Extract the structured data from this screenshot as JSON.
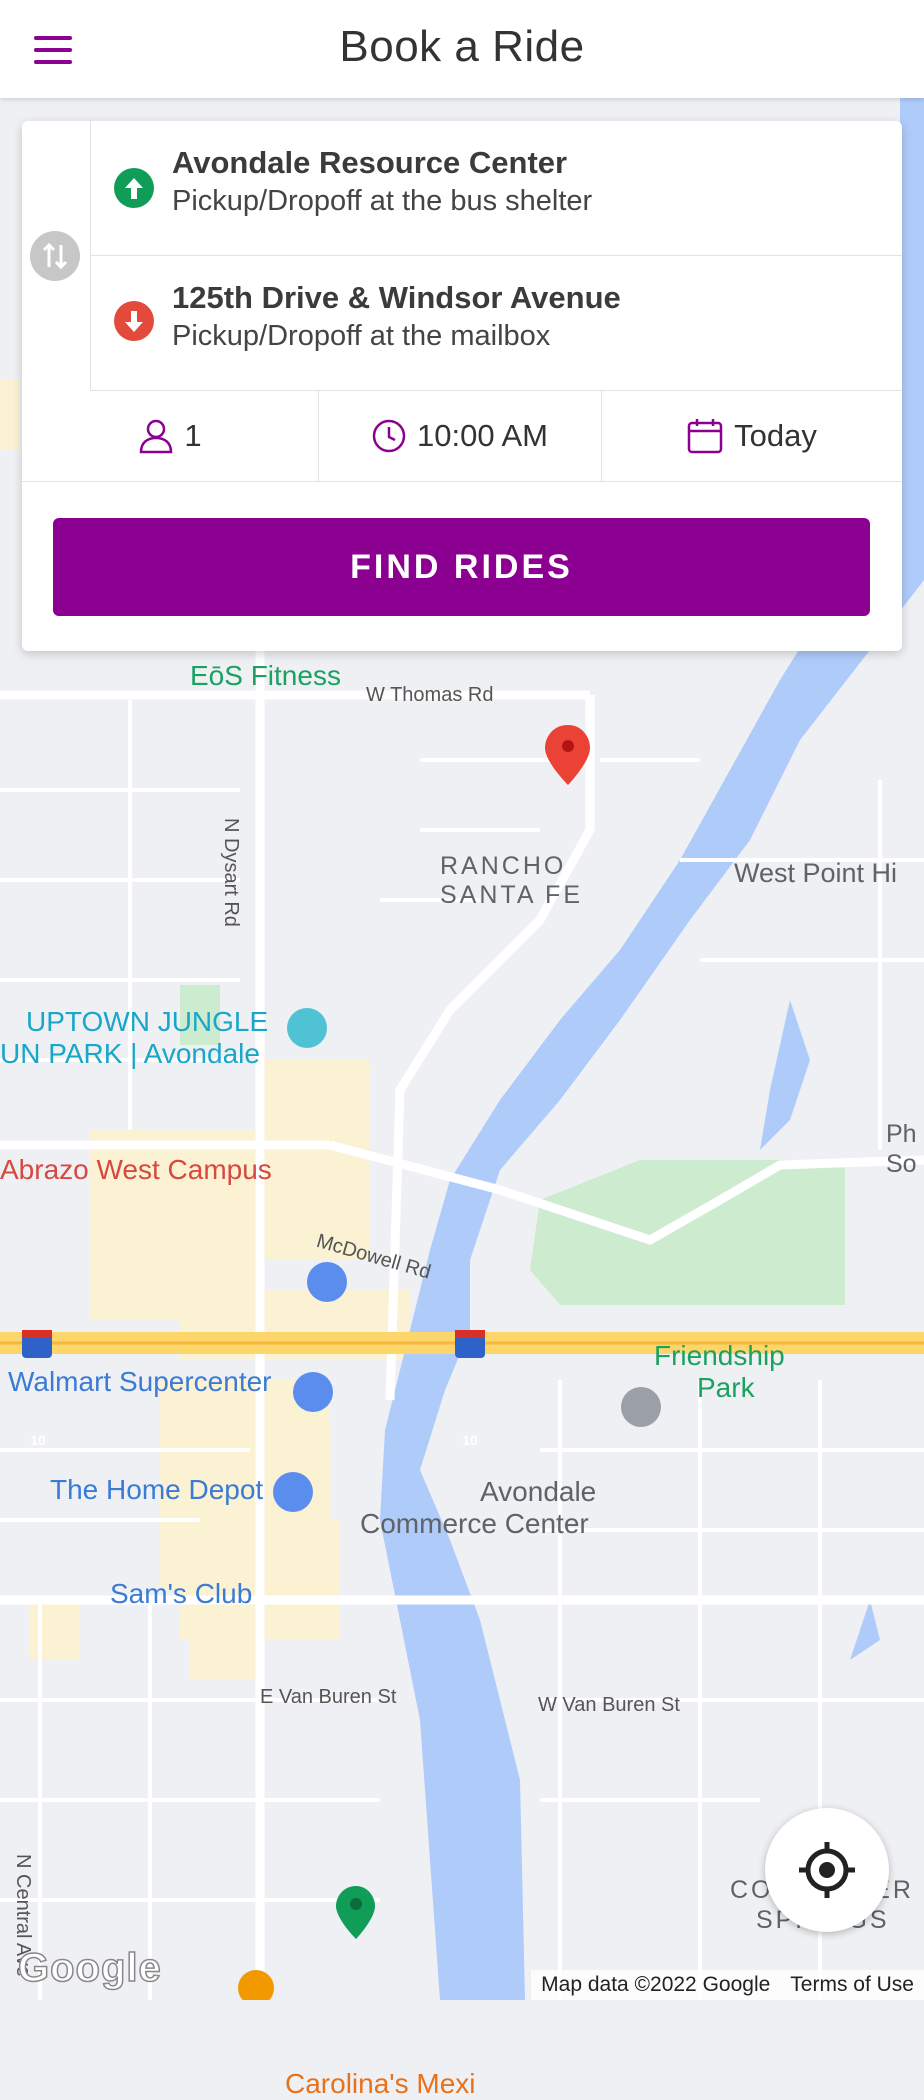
{
  "header": {
    "title": "Book a Ride",
    "menu_icon": "hamburger-menu-icon"
  },
  "booking": {
    "swap_icon": "swap-vertical-icon",
    "pickup": {
      "name": "Avondale Resource Center",
      "detail": "Pickup/Dropoff at the bus shelter",
      "icon": "arrow-up-circle-icon",
      "color": "#0f9d58"
    },
    "dropoff": {
      "name": "125th Drive & Windsor Avenue",
      "detail": "Pickup/Dropoff at the mailbox",
      "icon": "arrow-down-circle-icon",
      "color": "#e24b3b"
    },
    "riders": {
      "value": "1",
      "icon": "person-icon"
    },
    "time": {
      "value": "10:00 AM",
      "icon": "clock-icon"
    },
    "date": {
      "value": "Today",
      "icon": "calendar-icon"
    },
    "find_button": "FIND RIDES",
    "accent": "#8b0090"
  },
  "map": {
    "labels": {
      "eos": "EōS Fitness",
      "thomas": "W Thomas Rd",
      "dysart": "N Dysart Rd",
      "rancho": "RANCHO",
      "santa_fe": "SANTA FE",
      "west_point": "West Point Hi",
      "uptown1": "UPTOWN JUNGLE",
      "uptown2": "UN PARK | Avondale",
      "ph": "Ph",
      "so": "So",
      "abrazo": "Abrazo West Campus",
      "mcdowell": "McDowell Rd",
      "walmart": "Walmart Supercenter",
      "friendship1": "Friendship",
      "friendship2": "Park",
      "home_depot": "The Home Depot",
      "avondale1": "Avondale",
      "avondale2": "Commerce Center",
      "sams": "Sam's Club",
      "e_van_buren": "E Van Buren St",
      "w_van_buren": "W Van Buren St",
      "coldwater1": "COLDWATER",
      "coldwater2": "SPRINGS",
      "central": "N Central Ave",
      "carolinas": "Carolina's Mexi",
      "hwy": "10"
    },
    "locate_icon": "my-location-icon",
    "google": "Google",
    "map_data": "Map data ©2022 Google",
    "terms": "Terms of Use"
  }
}
